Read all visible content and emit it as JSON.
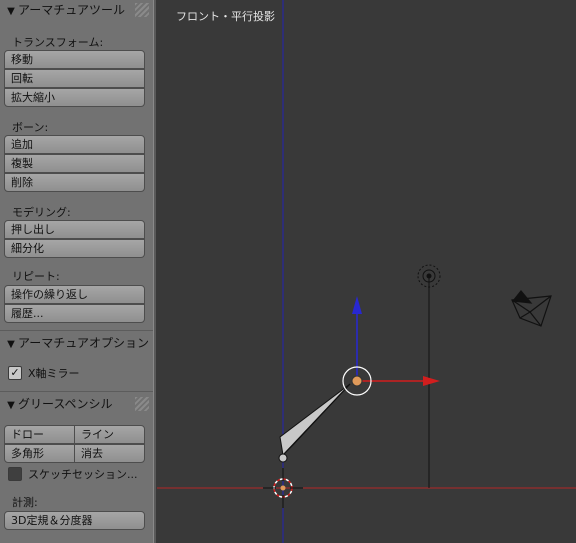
{
  "toolshelf": {
    "armature_tools": {
      "title": "アーマチュアツール",
      "transform": {
        "label": "トランスフォーム:",
        "buttons": [
          "移動",
          "回転",
          "拡大縮小"
        ]
      },
      "bone": {
        "label": "ボーン:",
        "buttons": [
          "追加",
          "複製",
          "削除"
        ]
      },
      "modeling": {
        "label": "モデリング:",
        "buttons": [
          "押し出し",
          "細分化"
        ]
      },
      "repeat": {
        "label": "リピート:",
        "buttons": [
          "操作の繰り返し",
          "履歴..."
        ]
      }
    },
    "armature_options": {
      "title": "アーマチュアオプション",
      "x_mirror": {
        "label": "X軸ミラー",
        "checked": true
      }
    },
    "grease_pencil": {
      "title": "グリースペンシル",
      "draw": "ドロー",
      "line": "ライン",
      "polygon": "多角形",
      "erase": "消去",
      "sketch_session": {
        "label": "スケッチセッション...",
        "checked": false
      },
      "measure_label": "計測:",
      "ruler": "3D定規＆分度器"
    }
  },
  "viewport": {
    "view_name": "フロント・平行投影",
    "colors": {
      "background": "#393939",
      "x_axis": "#d21e1e",
      "z_axis": "#2828d2",
      "bone": "#c8c8c8"
    },
    "icons": [
      "lamp-icon",
      "camera-icon",
      "3d-cursor-icon",
      "manipulator-widget"
    ]
  }
}
